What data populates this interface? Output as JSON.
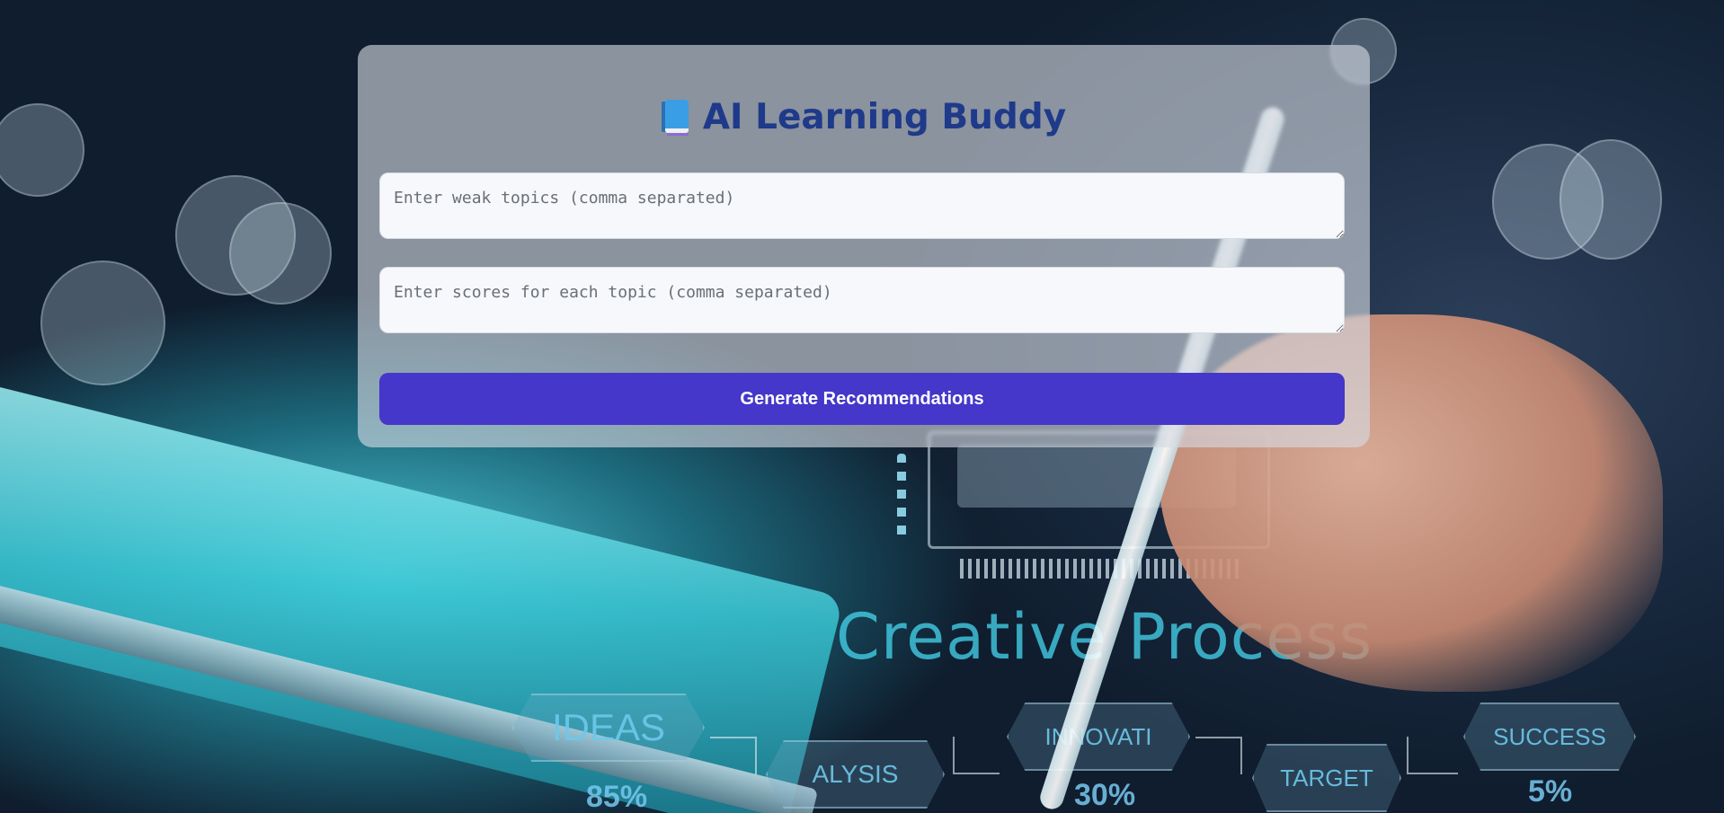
{
  "app": {
    "title": "AI Learning Buddy",
    "title_icon": "book-icon"
  },
  "form": {
    "weak_topics_placeholder": "Enter weak topics (comma separated)",
    "weak_topics_value": "",
    "scores_placeholder": "Enter scores for each topic (comma separated)",
    "scores_value": "",
    "submit_label": "Generate Recommendations"
  },
  "background": {
    "headline": "Creative Process",
    "steps": [
      "IDEAS",
      "ALYSIS",
      "INNOVATI",
      "TARGET",
      "SUCCESS"
    ],
    "percentages": [
      "85%",
      "30%",
      "5%"
    ]
  },
  "colors": {
    "title": "#1f3a8a",
    "button_bg": "#4437c9",
    "button_text": "#ffffff",
    "card_bg": "rgba(215,220,228,0.62)",
    "field_bg": "#f6f8fb"
  }
}
